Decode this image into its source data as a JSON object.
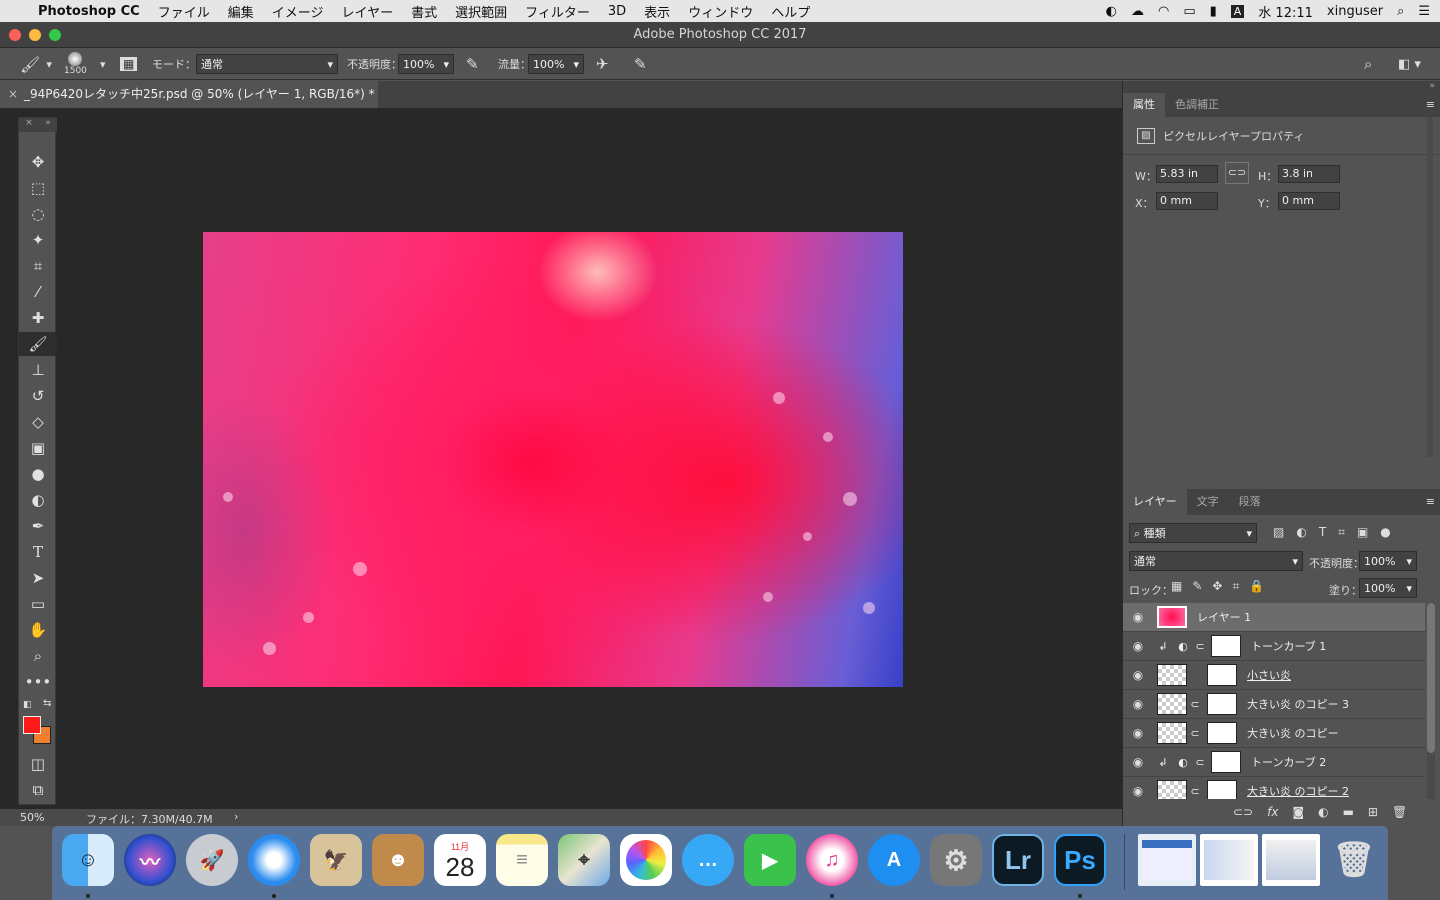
{
  "menubar": {
    "app": "Photoshop CC",
    "items": [
      "ファイル",
      "編集",
      "イメージ",
      "レイヤー",
      "書式",
      "選択範囲",
      "フィルター",
      "3D",
      "表示",
      "ウィンドウ",
      "ヘルプ"
    ],
    "clock": "水 12:11",
    "user": "xinguser",
    "input": "A"
  },
  "window": {
    "title": "Adobe Photoshop CC 2017"
  },
  "options": {
    "brush_size": "1500",
    "mode_label": "モード：",
    "mode_value": "通常",
    "opacity_label": "不透明度：",
    "opacity_value": "100%",
    "flow_label": "流量：",
    "flow_value": "100%"
  },
  "document": {
    "tab_title": "_94P6420レタッチ中25r.psd @ 50% (レイヤー 1, RGB/16*) *"
  },
  "status": {
    "zoom": "50%",
    "file": "ファイル：7.30M/40.7M"
  },
  "properties": {
    "tabs": [
      "属性",
      "色調補正"
    ],
    "header": "ピクセルレイヤープロパティ",
    "w_label": "W：",
    "w": "5.83 in",
    "h_label": "H：",
    "h": "3.8 in",
    "x_label": "X：",
    "x": "0 mm",
    "y_label": "Y：",
    "y": "0 mm"
  },
  "layers_panel": {
    "tabs": [
      "レイヤー",
      "文字",
      "段落"
    ],
    "filter": "種類",
    "blend": "通常",
    "opacity_label": "不透明度：",
    "opacity": "100%",
    "lock_label": "ロック：",
    "fill_label": "塗り：",
    "fill": "100%",
    "layers": [
      {
        "name": "レイヤー 1",
        "kind": "pixel",
        "selected": true
      },
      {
        "name": "トーンカーブ 1",
        "kind": "adjust"
      },
      {
        "name": "小さい炎",
        "kind": "masked",
        "underline": true
      },
      {
        "name": "大きい炎 のコピー 3",
        "kind": "masked"
      },
      {
        "name": "大きい炎 のコピー",
        "kind": "masked"
      },
      {
        "name": "トーンカーブ 2",
        "kind": "adjust"
      },
      {
        "name": "大きい炎 のコピー 2",
        "kind": "masked"
      }
    ]
  },
  "colors": {
    "foreground": "#ff1a1a",
    "background": "#f08030",
    "accent": "#4a90e2"
  },
  "dock": {
    "apps": [
      "finder-icon",
      "siri-icon",
      "launchpad-icon",
      "safari-icon",
      "preview-icon",
      "contacts-icon",
      "calendar-icon",
      "notes-icon",
      "maps-icon",
      "photos-icon",
      "messages-icon",
      "facetime-icon",
      "itunes-icon",
      "appstore-icon",
      "system-preferences-icon",
      "lightroom-icon",
      "photoshop-icon"
    ],
    "calendar_month": "11月",
    "calendar_day": "28",
    "lr": "Lr",
    "ps": "Ps"
  }
}
